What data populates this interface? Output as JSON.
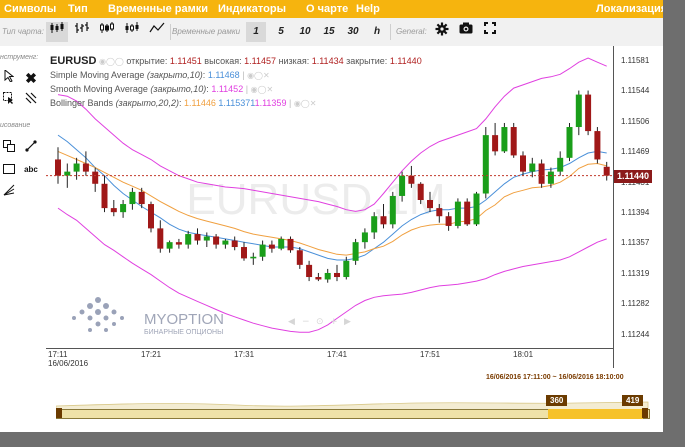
{
  "menu": {
    "items": [
      "Символы",
      "Тип",
      "Временные рамки",
      "Индикаторы",
      "О чарте",
      "Help"
    ],
    "right": "Локализация"
  },
  "toolbar": {
    "chart_type_label": "Тип чарта:",
    "timeframe_label": "Временные рамки",
    "timeframes": [
      "1",
      "5",
      "10",
      "15",
      "30",
      "h"
    ],
    "selected_timeframe": "1",
    "general_label": "General:"
  },
  "left_panel": {
    "tools_label": "нструменг:",
    "drawing_label": "исование",
    "text_tool": "abc"
  },
  "chart": {
    "symbol": "EURUSD",
    "ohlc": {
      "open_label": "открытие:",
      "open": "1.11451",
      "high_label": "высокая:",
      "high": "1.11457",
      "low_label": "низкая:",
      "low": "1.11434",
      "close_label": "закрытие:",
      "close": "1.11440"
    },
    "indicators": [
      {
        "name": "Simple Moving Average",
        "params": "(закрыто,10)",
        "values": [
          "1.11468"
        ],
        "color": "#4a90d9"
      },
      {
        "name": "Smooth Moving Average",
        "params": "(закрыто,10)",
        "values": [
          "1.11452"
        ],
        "color": "#f0a040"
      },
      {
        "name": "Bollinger Bands",
        "params": "(закрыто,20,2)",
        "values": [
          "1.11446",
          "1.115371",
          "1.11359"
        ],
        "color": "#e040e0"
      }
    ],
    "watermark": "EURUSD,1M",
    "logo": {
      "name": "MYOPTION",
      "subtitle": "БИНАРНЫЕ ОПЦИОНЫ"
    },
    "current_price": "1.11440",
    "price_ticks": [
      "1.11581",
      "1.11544",
      "1.11506",
      "1.11469",
      "1.11431",
      "1.11394",
      "1.11357",
      "1.11319",
      "1.11282",
      "1.11244"
    ],
    "time_ticks": [
      "17:11",
      "17:21",
      "17:31",
      "17:41",
      "17:51",
      "18:01"
    ],
    "date_label": "16/06/2016",
    "colors": {
      "up": "#1a9e1a",
      "down": "#a01818",
      "sma": "#4a90d9",
      "smooth": "#f0a040",
      "bollinger": "#e040e0"
    }
  },
  "chart_data": {
    "type": "candlestick",
    "symbol": "EURUSD",
    "timeframe": "1M",
    "ylim": [
      1.11225,
      1.11595
    ],
    "x_start": "17:11",
    "bar_minutes": 1,
    "candles": [
      [
        1.1146,
        1.11475,
        1.1143,
        1.1144
      ],
      [
        1.1144,
        1.11455,
        1.11425,
        1.11445
      ],
      [
        1.11445,
        1.11462,
        1.11435,
        1.11455
      ],
      [
        1.11455,
        1.1147,
        1.1144,
        1.11445
      ],
      [
        1.11445,
        1.1145,
        1.1142,
        1.1143
      ],
      [
        1.1143,
        1.1144,
        1.11395,
        1.114
      ],
      [
        1.114,
        1.1141,
        1.1139,
        1.11395
      ],
      [
        1.11395,
        1.1141,
        1.11388,
        1.11405
      ],
      [
        1.11405,
        1.11425,
        1.11398,
        1.1142
      ],
      [
        1.1142,
        1.11425,
        1.114,
        1.11405
      ],
      [
        1.11405,
        1.11408,
        1.1137,
        1.11375
      ],
      [
        1.11375,
        1.11385,
        1.11345,
        1.1135
      ],
      [
        1.1135,
        1.1136,
        1.11345,
        1.11358
      ],
      [
        1.11358,
        1.11362,
        1.1135,
        1.11355
      ],
      [
        1.11355,
        1.11372,
        1.1135,
        1.11368
      ],
      [
        1.11368,
        1.11375,
        1.11355,
        1.1136
      ],
      [
        1.1136,
        1.1137,
        1.11352,
        1.11365
      ],
      [
        1.11365,
        1.11368,
        1.1135,
        1.11355
      ],
      [
        1.11355,
        1.11362,
        1.1135,
        1.1136
      ],
      [
        1.1136,
        1.11365,
        1.11348,
        1.11352
      ],
      [
        1.11352,
        1.11358,
        1.11335,
        1.11338
      ],
      [
        1.11338,
        1.11345,
        1.1133,
        1.1134
      ],
      [
        1.1134,
        1.1136,
        1.11335,
        1.11355
      ],
      [
        1.11355,
        1.1136,
        1.11345,
        1.1135
      ],
      [
        1.1135,
        1.11365,
        1.11348,
        1.11362
      ],
      [
        1.11362,
        1.11365,
        1.11345,
        1.11348
      ],
      [
        1.11348,
        1.11352,
        1.11325,
        1.1133
      ],
      [
        1.1133,
        1.11335,
        1.1131,
        1.11315
      ],
      [
        1.11315,
        1.1132,
        1.1131,
        1.11312
      ],
      [
        1.11312,
        1.11325,
        1.11308,
        1.1132
      ],
      [
        1.1132,
        1.1133,
        1.1131,
        1.11315
      ],
      [
        1.11315,
        1.1134,
        1.11312,
        1.11335
      ],
      [
        1.11335,
        1.11362,
        1.1133,
        1.11358
      ],
      [
        1.11358,
        1.11375,
        1.1135,
        1.1137
      ],
      [
        1.1137,
        1.11395,
        1.11362,
        1.1139
      ],
      [
        1.1139,
        1.11405,
        1.11375,
        1.1138
      ],
      [
        1.1138,
        1.1142,
        1.11375,
        1.11415
      ],
      [
        1.11415,
        1.11445,
        1.11408,
        1.1144
      ],
      [
        1.1144,
        1.11452,
        1.11425,
        1.1143
      ],
      [
        1.1143,
        1.11432,
        1.11405,
        1.1141
      ],
      [
        1.1141,
        1.1142,
        1.11395,
        1.114
      ],
      [
        1.114,
        1.11405,
        1.11382,
        1.1139
      ],
      [
        1.1139,
        1.11395,
        1.11372,
        1.11378
      ],
      [
        1.11378,
        1.11412,
        1.11375,
        1.11408
      ],
      [
        1.11408,
        1.11412,
        1.11378,
        1.1138
      ],
      [
        1.1138,
        1.1142,
        1.11378,
        1.11418
      ],
      [
        1.11418,
        1.115,
        1.11412,
        1.1149
      ],
      [
        1.1149,
        1.11505,
        1.11465,
        1.1147
      ],
      [
        1.1147,
        1.11505,
        1.11468,
        1.115
      ],
      [
        1.115,
        1.11505,
        1.11462,
        1.11465
      ],
      [
        1.11465,
        1.1147,
        1.1144,
        1.11445
      ],
      [
        1.11445,
        1.11462,
        1.11438,
        1.11455
      ],
      [
        1.11455,
        1.1146,
        1.11425,
        1.1143
      ],
      [
        1.1143,
        1.1145,
        1.11425,
        1.11445
      ],
      [
        1.11445,
        1.1147,
        1.1144,
        1.11462
      ],
      [
        1.11462,
        1.11505,
        1.11458,
        1.115
      ],
      [
        1.115,
        1.11545,
        1.1149,
        1.1154
      ],
      [
        1.1154,
        1.11545,
        1.1149,
        1.11495
      ],
      [
        1.11495,
        1.115,
        1.11455,
        1.1146
      ],
      [
        1.11451,
        1.11457,
        1.11434,
        1.1144
      ]
    ],
    "series": [
      {
        "name": "Simple Moving Average",
        "values": [
          1.1149,
          1.11482,
          1.11472,
          1.11462,
          1.1145,
          1.1144,
          1.11428,
          1.11418,
          1.1141,
          1.11402,
          1.11395,
          1.11388,
          1.1138,
          1.11374,
          1.1137,
          1.11368,
          1.11366,
          1.11364,
          1.11362,
          1.1136,
          1.11358,
          1.11356,
          1.11354,
          1.11352,
          1.11352,
          1.11352,
          1.1135,
          1.11346,
          1.11342,
          1.11338,
          1.11336,
          1.11336,
          1.11338,
          1.11342,
          1.1135,
          1.11358,
          1.11368,
          1.11378,
          1.11386,
          1.11392,
          1.11396,
          1.11398,
          1.11398,
          1.114,
          1.114,
          1.11402,
          1.1141,
          1.1142,
          1.1143,
          1.11438,
          1.11442,
          1.11445,
          1.11447,
          1.11448,
          1.1145,
          1.11455,
          1.11462,
          1.11468,
          1.1147,
          1.11468
        ]
      },
      {
        "name": "Smooth Moving Average",
        "values": [
          1.1147,
          1.11465,
          1.1146,
          1.11455,
          1.1145,
          1.11444,
          1.11438,
          1.11432,
          1.11427,
          1.11422,
          1.11415,
          1.11408,
          1.11402,
          1.11396,
          1.11391,
          1.11387,
          1.11384,
          1.11381,
          1.11378,
          1.11375,
          1.11371,
          1.11368,
          1.11366,
          1.11364,
          1.11362,
          1.1136,
          1.11357,
          1.11353,
          1.11349,
          1.11346,
          1.11343,
          1.11342,
          1.11344,
          1.11346,
          1.1135,
          1.11353,
          1.11359,
          1.11367,
          1.11373,
          1.11377,
          1.11379,
          1.1138,
          1.1138,
          1.11383,
          1.11384,
          1.11387,
          1.11397,
          1.11404,
          1.11414,
          1.11419,
          1.11422,
          1.11425,
          1.11426,
          1.11428,
          1.11432,
          1.11439,
          1.11449,
          1.11454,
          1.11455,
          1.11452
        ]
      },
      {
        "name": "Bollinger Bands upper",
        "values": [
          1.1154,
          1.11538,
          1.11532,
          1.11522,
          1.1151,
          1.115,
          1.1149,
          1.1148,
          1.11472,
          1.11466,
          1.1146,
          1.11452,
          1.11446,
          1.1144,
          1.11436,
          1.11432,
          1.1143,
          1.11428,
          1.11426,
          1.11425,
          1.11424,
          1.11422,
          1.1142,
          1.11418,
          1.11416,
          1.11414,
          1.11412,
          1.1141,
          1.11408,
          1.11405,
          1.11402,
          1.11398,
          1.11396,
          1.11398,
          1.11405,
          1.11418,
          1.11432,
          1.11446,
          1.11458,
          1.11468,
          1.11476,
          1.11482,
          1.11486,
          1.1149,
          1.11494,
          1.11498,
          1.1151,
          1.11525,
          1.11538,
          1.11548,
          1.11552,
          1.11556,
          1.1156,
          1.11562,
          1.11565,
          1.11572,
          1.1158,
          1.11585,
          1.1158,
          1.11575
        ]
      },
      {
        "name": "Bollinger Bands middle",
        "values": [
          1.11445,
          1.1144,
          1.11435,
          1.1143,
          1.11425,
          1.1142,
          1.11415,
          1.1141,
          1.11405,
          1.114,
          1.11395,
          1.1139,
          1.11385,
          1.1138,
          1.11376,
          1.11372,
          1.11369,
          1.11366,
          1.11363,
          1.11361,
          1.1136,
          1.11359,
          1.11358,
          1.11357,
          1.11356,
          1.11355,
          1.11353,
          1.11351,
          1.11349,
          1.11347,
          1.11346,
          1.11346,
          1.11348,
          1.11352,
          1.11358,
          1.11365,
          1.11372,
          1.1138,
          1.11387,
          1.11392,
          1.11395,
          1.11397,
          1.11398,
          1.114,
          1.11401,
          1.11403,
          1.11408,
          1.11414,
          1.1142,
          1.11426,
          1.1143,
          1.11433,
          1.11436,
          1.11438,
          1.1144,
          1.11443,
          1.11446,
          1.11448,
          1.11449,
          1.11446
        ]
      },
      {
        "name": "Bollinger Bands lower",
        "values": [
          1.114,
          1.11392,
          1.11385,
          1.11375,
          1.11365,
          1.11355,
          1.11348,
          1.1134,
          1.11332,
          1.11325,
          1.11318,
          1.1131,
          1.11302,
          1.11295,
          1.1129,
          1.11285,
          1.1128,
          1.11275,
          1.1127,
          1.11266,
          1.11262,
          1.11258,
          1.11255,
          1.11252,
          1.1125,
          1.11248,
          1.11247,
          1.11247,
          1.1125,
          1.11256,
          1.11264,
          1.11272,
          1.1128,
          1.11286,
          1.1129,
          1.11292,
          1.11293,
          1.11294,
          1.11296,
          1.11299,
          1.11302,
          1.11304,
          1.11305,
          1.11306,
          1.11308,
          1.1131,
          1.11313,
          1.11318,
          1.11322,
          1.11325,
          1.11328,
          1.1133,
          1.11332,
          1.11334,
          1.11336,
          1.1134,
          1.11346,
          1.11352,
          1.11358,
          1.11362
        ]
      }
    ]
  },
  "navigator": {
    "range_text": "16/06/2016 17:11:00 ~ 16/06/2016 18:10:00",
    "start_badge": "360",
    "end_badge": "419"
  }
}
